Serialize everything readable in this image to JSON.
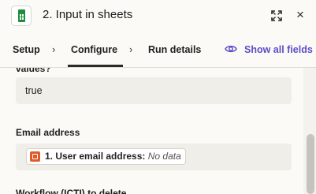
{
  "header": {
    "step_title": "2. Input in sheets",
    "app_icon": "google-sheets-icon",
    "expand_icon": "expand-icon",
    "close_glyph": "×"
  },
  "tabs": {
    "items": [
      {
        "label": "Setup"
      },
      {
        "label": "Configure"
      },
      {
        "label": "Run details"
      }
    ],
    "active": "Configure",
    "show_all_label": "Show all fields"
  },
  "form": {
    "previous_field_label_partial": "values?",
    "previous_field_value": "true",
    "email_label": "Email address",
    "email_pill": {
      "name": "1. User email address:",
      "value": "No data"
    },
    "next_field_label_partial": "Workflow (ICTI) to delete"
  },
  "colors": {
    "accent": "#5b4ec7",
    "sheets_green": "#1e8e3e",
    "trigger_orange": "#e15b28",
    "background": "#fbfaf6",
    "field_background": "#efeee9"
  }
}
